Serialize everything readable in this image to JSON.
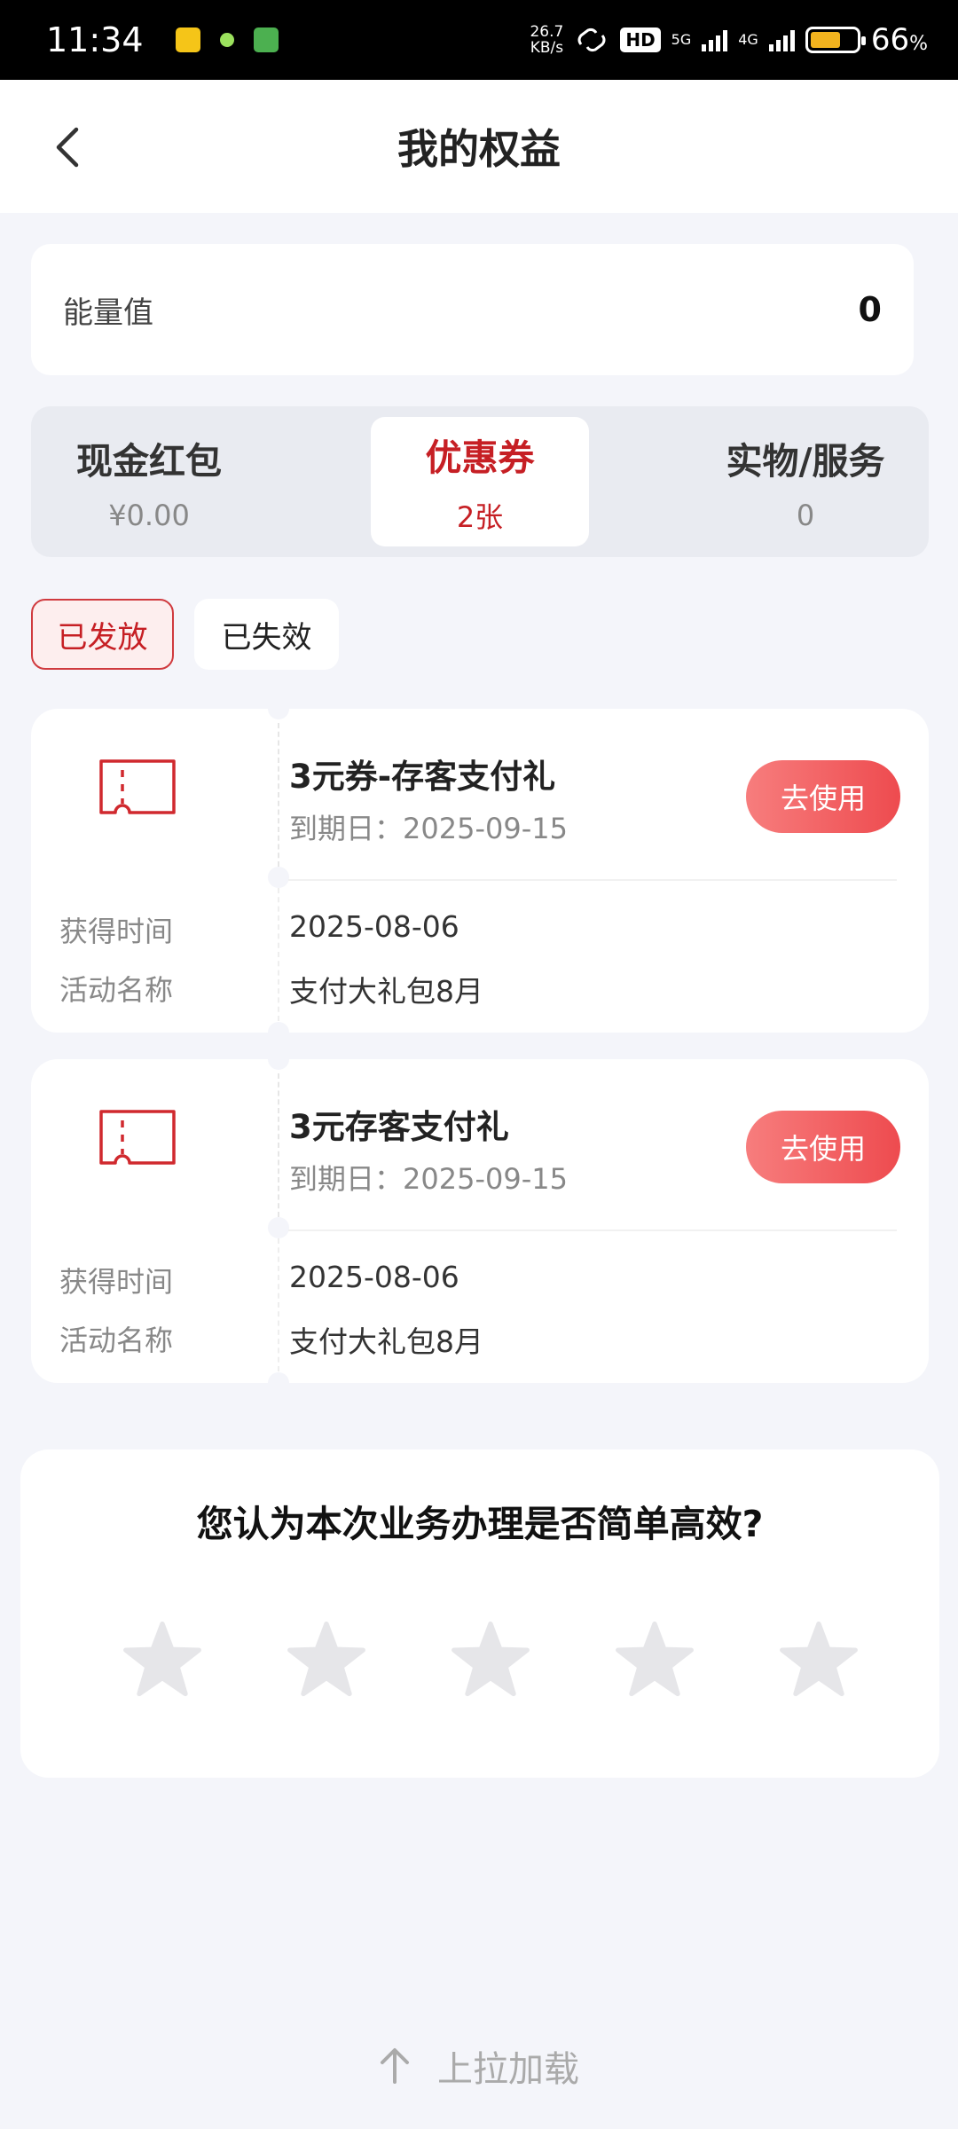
{
  "statusbar": {
    "time": "11:34",
    "net_speed": "26.7",
    "net_speed_unit": "KB/s",
    "hd_label": "HD",
    "net5g": "5G",
    "net4g": "4G",
    "battery_percent": "66",
    "battery_unit": "%"
  },
  "header": {
    "title": "我的权益"
  },
  "energy": {
    "label": "能量值",
    "value": "0"
  },
  "type_tabs": [
    {
      "label": "现金红包",
      "count": "¥0.00"
    },
    {
      "label": "优惠券",
      "count": "2张"
    },
    {
      "label": "实物/服务",
      "count": "0"
    }
  ],
  "filters": {
    "issued": "已发放",
    "expired": "已失效"
  },
  "coupons": [
    {
      "name": "3元券-存客支付礼",
      "expire": "到期日：2025-09-15",
      "use_label": "去使用",
      "obtain_label": "获得时间",
      "obtain_value": "2025-08-06",
      "activity_label": "活动名称",
      "activity_value": "支付大礼包8月"
    },
    {
      "name": "3元存客支付礼",
      "expire": "到期日：2025-09-15",
      "use_label": "去使用",
      "obtain_label": "获得时间",
      "obtain_value": "2025-08-06",
      "activity_label": "活动名称",
      "activity_value": "支付大礼包8月"
    }
  ],
  "rating": {
    "question": "您认为本次业务办理是否简单高效?",
    "star_count": 5,
    "selected": 0
  },
  "footer": {
    "pull_load": "上拉加载"
  },
  "colors": {
    "accent": "#c61f24",
    "button_start": "#f77d7d",
    "button_end": "#ee4b4f",
    "page_bg": "#f4f5fa"
  }
}
